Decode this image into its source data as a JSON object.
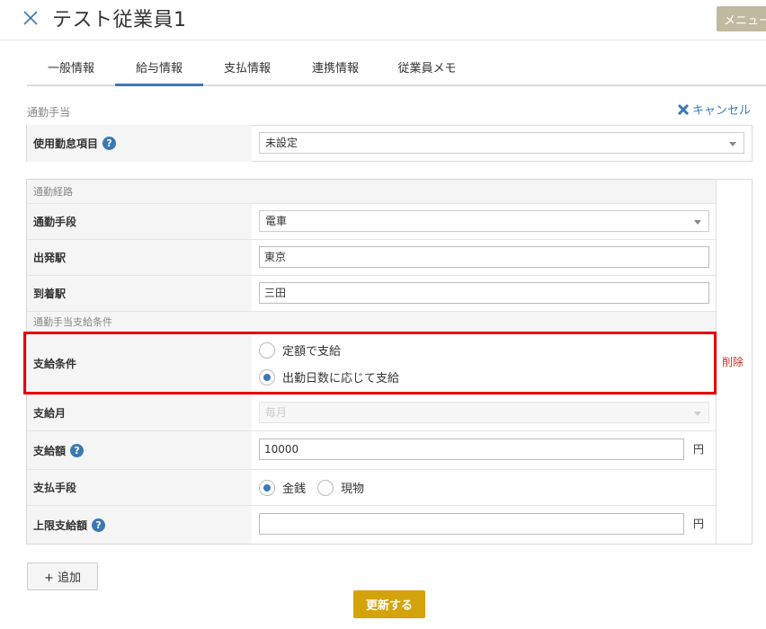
{
  "header": {
    "title": "テスト従業員1",
    "menu_label": "メニュー"
  },
  "tabs": [
    {
      "label": "一般情報",
      "active": false
    },
    {
      "label": "給与情報",
      "active": true
    },
    {
      "label": "支払情報",
      "active": false
    },
    {
      "label": "連携情報",
      "active": false
    },
    {
      "label": "従業員メモ",
      "active": false
    }
  ],
  "commute_allowance": {
    "section_label": "通勤手当",
    "cancel_label": "キャンセル",
    "attendance_item": {
      "label": "使用勤怠項目",
      "help": "?",
      "value": "未設定"
    }
  },
  "route": {
    "subhead": "通勤経路",
    "means": {
      "label": "通勤手段",
      "value": "電車"
    },
    "departure": {
      "label": "出発駅",
      "value": "東京"
    },
    "arrival": {
      "label": "到着駅",
      "value": "三田"
    }
  },
  "conditions": {
    "subhead": "通勤手当支給条件",
    "payment_condition": {
      "label": "支給条件",
      "options": [
        "定額で支給",
        "出勤日数に応じて支給"
      ],
      "selected": 1
    },
    "payment_month": {
      "label": "支給月",
      "value": "毎月"
    },
    "amount": {
      "label": "支給額",
      "help": "?",
      "value": "10000",
      "unit": "円"
    },
    "payment_method": {
      "label": "支払手段",
      "options": [
        "金銭",
        "現物"
      ],
      "selected": 0
    },
    "max_amount": {
      "label": "上限支給額",
      "help": "?",
      "value": "",
      "unit": "円"
    }
  },
  "delete_label": "削除",
  "add_label": "+ 追加",
  "update_label": "更新する",
  "colors": {
    "accent": "#3b78b4",
    "highlight": "#e8000b",
    "update_button": "#d4a30c",
    "menu_button": "#bfb9a0",
    "delete": "#c9302c"
  }
}
